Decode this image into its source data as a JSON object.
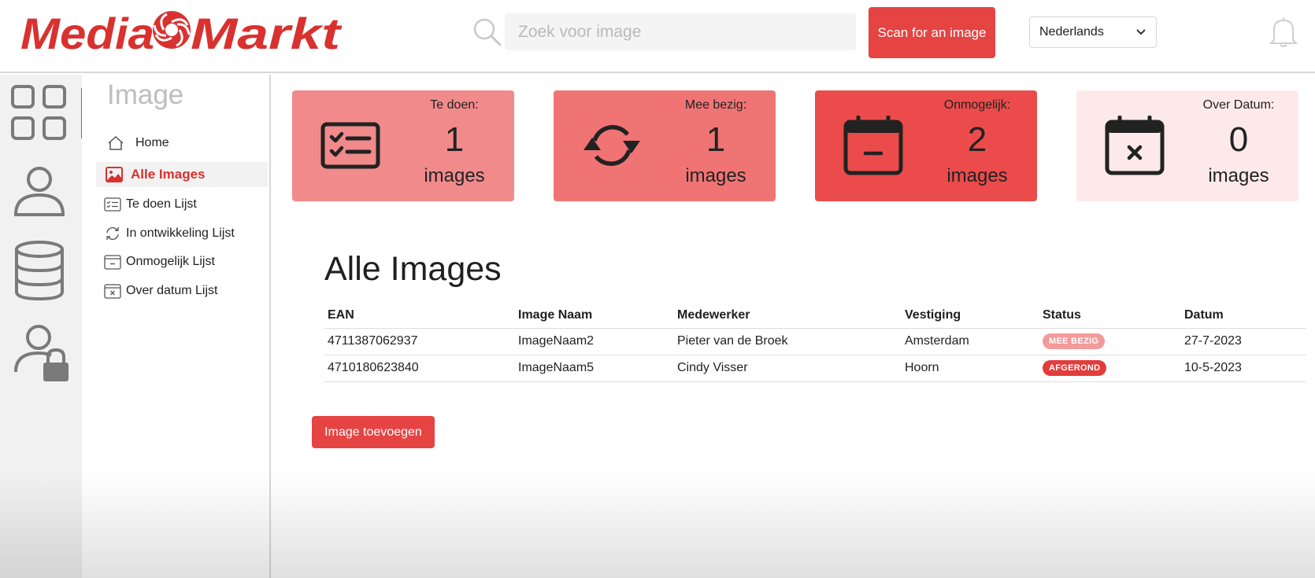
{
  "brand": {
    "logo_text": "MediaMarkt",
    "accent": "#e64343",
    "logo_red": "#d9312f"
  },
  "header": {
    "search_placeholder": "Zoek voor image",
    "scan_button": "Scan for an image",
    "language": "Nederlands",
    "bell_icon": "bell-icon"
  },
  "rail": {
    "icons": [
      "dashboard-grid-icon",
      "user-icon",
      "database-icon",
      "user-lock-icon"
    ]
  },
  "sidebar": {
    "title": "Image",
    "items": [
      {
        "label": "Home",
        "icon": "home-icon"
      },
      {
        "label": "Alle Images",
        "icon": "image-icon",
        "active": true
      },
      {
        "label": "Te doen Lijst",
        "icon": "checklist-icon"
      },
      {
        "label": "In ontwikkeling Lijst",
        "icon": "refresh-icon"
      },
      {
        "label": "Onmogelijk Lijst",
        "icon": "calendar-minus-icon"
      },
      {
        "label": "Over datum Lijst",
        "icon": "calendar-x-icon"
      }
    ]
  },
  "cards": [
    {
      "label": "Te doen:",
      "count": "1",
      "unit": "images",
      "icon": "checklist-icon",
      "color": "#f18a8a"
    },
    {
      "label": "Mee bezig:",
      "count": "1",
      "unit": "images",
      "icon": "refresh-icon",
      "color": "#f07474"
    },
    {
      "label": "Onmogelijk:",
      "count": "2",
      "unit": "images",
      "icon": "calendar-minus-icon",
      "color": "#ec4b4b"
    },
    {
      "label": "Over Datum:",
      "count": "0",
      "unit": "images",
      "icon": "calendar-x-icon",
      "color": "#fde9e9"
    }
  ],
  "main": {
    "title": "Alle Images",
    "columns": [
      "EAN",
      "Image Naam",
      "Medewerker",
      "Vestiging",
      "Status",
      "Datum"
    ],
    "rows": [
      {
        "ean": "4711387062937",
        "name": "ImageNaam2",
        "employee": "Pieter van de Broek",
        "location": "Amsterdam",
        "status": "MEE BEZIG",
        "status_color": "#f39a9a",
        "date": "27-7-2023"
      },
      {
        "ean": "4710180623840",
        "name": "ImageNaam5",
        "employee": "Cindy Visser",
        "location": "Hoorn",
        "status": "AFGEROND",
        "status_color": "#e23c3c",
        "date": "10-5-2023"
      }
    ],
    "add_button": "Image toevoegen"
  }
}
